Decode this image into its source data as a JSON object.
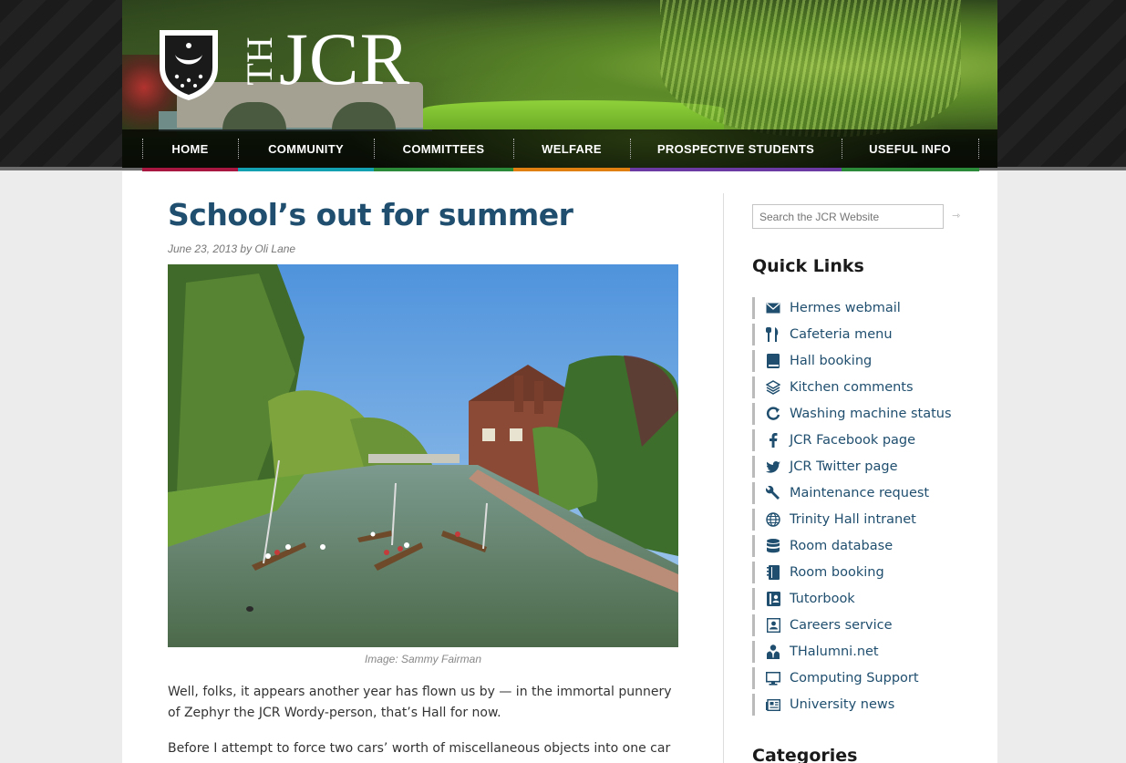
{
  "header": {
    "logo_text": "JCR",
    "logo_prefix": "TH"
  },
  "nav": {
    "items": [
      {
        "label": "HOME",
        "color": "#a7173f"
      },
      {
        "label": "COMMUNITY",
        "color": "#13a1b1"
      },
      {
        "label": "COMMITTEES",
        "color": "#2b8a3a"
      },
      {
        "label": "WELFARE",
        "color": "#e07f12"
      },
      {
        "label": "PROSPECTIVE STUDENTS",
        "color": "#6b3aa2"
      },
      {
        "label": "USEFUL INFO",
        "color": "#2b8a3a"
      }
    ]
  },
  "post": {
    "title": "School’s out for summer",
    "meta": "June 23, 2013 by Oli Lane",
    "caption": "Image: Sammy Fairman",
    "paragraph1": "Well, folks, it appears another year has flown us by — in the immortal punnery of Zephyr the JCR Wordy-person, that’s Hall for now.",
    "paragraph2": "Before I attempt to force two cars’ worth of miscellaneous objects into one car and"
  },
  "sidebar": {
    "search_placeholder": "Search the JCR Website",
    "quick_links_heading": "Quick Links",
    "categories_heading": "Categories",
    "quick_links": [
      {
        "label": "Hermes webmail",
        "icon": "envelope-icon"
      },
      {
        "label": "Cafeteria menu",
        "icon": "cutlery-icon"
      },
      {
        "label": "Hall booking",
        "icon": "book-icon"
      },
      {
        "label": "Kitchen comments",
        "icon": "layers-icon"
      },
      {
        "label": "Washing machine status",
        "icon": "refresh-icon"
      },
      {
        "label": "JCR Facebook page",
        "icon": "facebook-icon"
      },
      {
        "label": "JCR Twitter page",
        "icon": "twitter-icon"
      },
      {
        "label": "Maintenance request",
        "icon": "wrench-icon"
      },
      {
        "label": "Trinity Hall intranet",
        "icon": "globe-icon"
      },
      {
        "label": "Room database",
        "icon": "database-icon"
      },
      {
        "label": "Room booking",
        "icon": "notebook-icon"
      },
      {
        "label": "Tutorbook",
        "icon": "contact-book-icon"
      },
      {
        "label": "Careers service",
        "icon": "id-card-icon"
      },
      {
        "label": "THalumni.net",
        "icon": "user-tie-icon"
      },
      {
        "label": "Computing Support",
        "icon": "monitor-icon"
      },
      {
        "label": "University news",
        "icon": "newspaper-icon"
      }
    ]
  }
}
